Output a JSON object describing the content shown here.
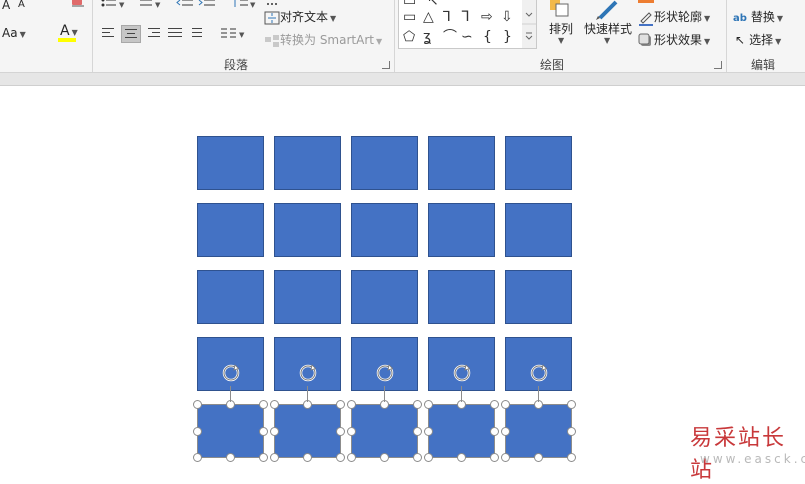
{
  "ribbon": {
    "font": {
      "grow_label": "A",
      "shrink_label": "A",
      "change_case_label": "Aa",
      "highlight_label": "A",
      "highlight_color": "#ffff00"
    },
    "paragraph": {
      "group_label": "段落",
      "text_direction_label": "↕",
      "align_text_label": "对齐文本",
      "convert_smartart_label": "转换为 SmartArt"
    },
    "drawing": {
      "group_label": "绘图",
      "arrange_label": "排列",
      "quick_styles_label": "快速样式",
      "shape_outline_label": "形状轮廓",
      "shape_effects_label": "形状效果",
      "outline_color": "#4472c4",
      "fill_color": "#ed7d31"
    },
    "editing": {
      "group_label": "编辑",
      "replace_label": "替换",
      "select_label": "选择"
    }
  },
  "shapes": {
    "fill": "#4472c4",
    "border": "#2f528f",
    "rows": 5,
    "cols": 5
  },
  "watermark": {
    "title": "易采站长站",
    "subtitle": "www.easck.com"
  }
}
